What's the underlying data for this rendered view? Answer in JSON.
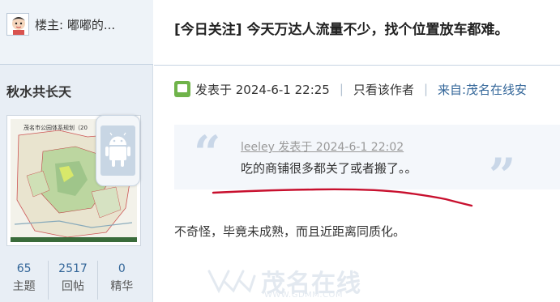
{
  "sidebar": {
    "op_label": "楼主: 嘟嘟的...",
    "username": "秋水共长天",
    "avatar_map_title": "茂名市公园体系规划（20",
    "stats": [
      {
        "value": "65",
        "label": "主题"
      },
      {
        "value": "2517",
        "label": "回帖"
      },
      {
        "value": "0",
        "label": "精华"
      }
    ],
    "mobile_badge_icon": "android-icon"
  },
  "thread": {
    "title": "[今日关注] 今天万达人流量不少，找个位置放车都难。"
  },
  "post": {
    "posted_at": "发表于 2024-6-1 22:25",
    "only_author": "只看该作者",
    "from": "来自:茂名在线安",
    "quote": {
      "author_line": "leeley 发表于 2024-6-1 22:02",
      "text": "吃的商铺很多都关了或者搬了。。"
    },
    "reply": "不奇怪，毕竟未成熟，而且近距离同质化。"
  },
  "watermark": {
    "text": "茂名在线",
    "url": "WWW.GDMM.COM"
  },
  "colors": {
    "sidebar_bg": "#e8eef5",
    "link_blue": "#336699",
    "annotation_red": "#c8102e",
    "quote_bg": "#f4f7fb"
  }
}
